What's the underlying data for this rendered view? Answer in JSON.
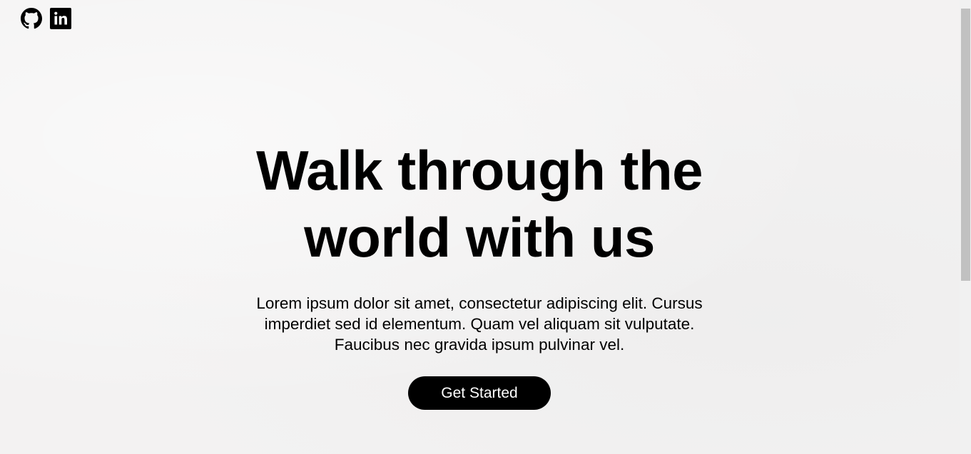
{
  "social": {
    "github_icon": "github-icon",
    "linkedin_icon": "linkedin-icon"
  },
  "hero": {
    "title_line1": "Walk through the",
    "title_line2": "world with us",
    "description": "Lorem ipsum dolor sit amet, consectetur adipiscing elit. Cursus imperdiet sed id elementum. Quam vel aliquam sit vulputate. Faucibus nec gravida ipsum pulvinar vel.",
    "button_label": "Get Started"
  },
  "colors": {
    "background": "#f4f3f3",
    "text": "#000000",
    "button_bg": "#000000",
    "button_text": "#ffffff"
  }
}
